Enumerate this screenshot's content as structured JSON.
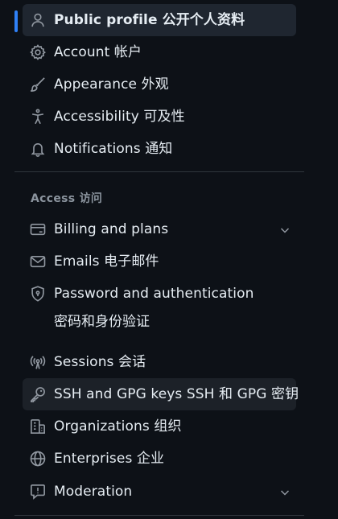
{
  "nav": {
    "items_top": [
      {
        "label": "Public profile  公开个人资料",
        "icon": "person-icon"
      },
      {
        "label": "Account  帐户",
        "icon": "gear-icon"
      },
      {
        "label": "Appearance  外观",
        "icon": "paintbrush-icon"
      },
      {
        "label": "Accessibility  可及性",
        "icon": "accessibility-icon"
      },
      {
        "label": "Notifications  通知",
        "icon": "bell-icon"
      }
    ],
    "access_heading": "Access  访问",
    "items_access": [
      {
        "label": "Billing and plans",
        "icon": "credit-card-icon",
        "expandable": true
      },
      {
        "label": "Emails  电子邮件",
        "icon": "mail-icon"
      },
      {
        "label": "Password and authentication",
        "label_line2": "密码和身份验证",
        "icon": "shield-lock-icon"
      },
      {
        "label": "Sessions  会话",
        "icon": "broadcast-icon"
      },
      {
        "label": "SSH and GPG keys  SSH 和 GPG 密钥",
        "icon": "key-icon"
      },
      {
        "label": "Organizations  组织",
        "icon": "organization-icon"
      },
      {
        "label": "Enterprises  企业",
        "icon": "globe-icon"
      },
      {
        "label": "Moderation",
        "icon": "report-icon",
        "expandable": true
      }
    ]
  },
  "colors": {
    "background": "#0d1117",
    "text": "#e6edf3",
    "icon": "#9198a1",
    "accent": "#2f81f7",
    "selected_bg": "#1f2630",
    "muted": "#8b949e",
    "divider": "#30363d"
  }
}
